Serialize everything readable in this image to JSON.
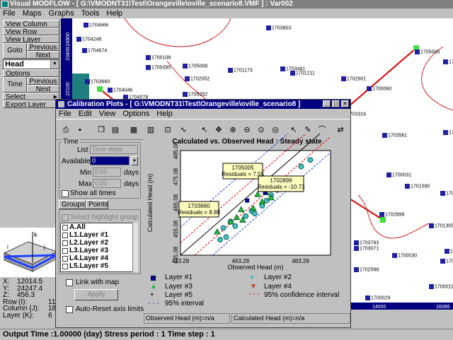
{
  "app": {
    "title": "Visual MODFLOW - [ G:\\VMODNT31\\Test\\Orangeville\\oville_scenario8.VMF ] : Var002"
  },
  "menu": [
    "File",
    "Maps",
    "Graphs",
    "Tools",
    "Help"
  ],
  "sidebar": {
    "view_column": "View Column",
    "view_row": "View Row",
    "view_layer": "View Layer",
    "goto": "Goto",
    "previous": "Previous",
    "next": "Next",
    "head_select": "Head",
    "options": "Options",
    "time": "Time",
    "time_previous": "Previous",
    "time_next": "Next",
    "select": "Select",
    "export_layer": "Export Layer"
  },
  "coords": {
    "x": {
      "label": "X:",
      "value": "12014.5"
    },
    "y": {
      "label": "Y:",
      "value": "24247.4"
    },
    "z": {
      "label": "Z:",
      "value": "456.3"
    },
    "row": {
      "label": "Row",
      "unit": "(I):",
      "value": "11"
    },
    "column": {
      "label": "Column (J):",
      "value": "18"
    },
    "layer": {
      "label": "Layer (K):",
      "value": "6"
    }
  },
  "map": {
    "axis_top": [
      "24800",
      "23400",
      "22100"
    ],
    "axis_bottom": [
      "14000",
      "16086"
    ],
    "wells": [
      {
        "label": "1704666"
      },
      {
        "label": "1703803"
      },
      {
        "label": "1704248"
      },
      {
        "label": "1704674"
      },
      {
        "label": "1700108"
      },
      {
        "label": "1705095"
      },
      {
        "label": "1705008"
      },
      {
        "label": "1703660"
      },
      {
        "label": "1704046"
      },
      {
        "label": "1704078"
      },
      {
        "label": "1702052"
      },
      {
        "label": "1705252"
      },
      {
        "label": "1701173"
      },
      {
        "label": "1703491"
      },
      {
        "label": "1701211"
      },
      {
        "label": "1702601"
      },
      {
        "label": "1700060"
      },
      {
        "label": "1705005"
      },
      {
        "label": "1701767"
      },
      {
        "label": "1703316"
      },
      {
        "label": "1703561"
      },
      {
        "label": "1702889"
      },
      {
        "label": "1702899"
      },
      {
        "label": "1700031"
      },
      {
        "label": "1701595"
      },
      {
        "label": "1701057"
      },
      {
        "label": "1701305"
      },
      {
        "label": "1703783"
      },
      {
        "label": "1703071"
      },
      {
        "label": "1700030"
      },
      {
        "label": "1702598"
      },
      {
        "label": "1700011"
      },
      {
        "label": "1700029"
      },
      {
        "label": "1700317"
      },
      {
        "label": "1704155"
      }
    ]
  },
  "dialog": {
    "title": "Calibration Plots - [ G:\\VMODNT31\\Test\\Orangeville\\oville_scenario8 ]",
    "menu": [
      "File",
      "Edit",
      "View",
      "Options",
      "Help"
    ],
    "time_group": "Time",
    "list_label": "List",
    "list_value": "Time steps",
    "available_label": "Available:",
    "available_value": "0",
    "min_label": "Min",
    "min_value": "0.00",
    "min_unit": "days",
    "max_label": "Max",
    "max_value": "0.00",
    "max_unit": "days",
    "show_all_times": "Show all times",
    "tab_groups": "Groups",
    "tab_points": "Points",
    "highlight": "Select highlight group",
    "groups": [
      "A.All",
      "L1.Layer #1",
      "L2.Layer #2",
      "L3.Layer #3",
      "L4.Layer #4",
      "L5.Layer #5"
    ],
    "link_with_map": "Link with map",
    "apply": "Apply",
    "auto_reset": "Auto-Reset axis limits",
    "status_observed": "Observed Head (m)=n/a",
    "status_calculated": "Calculated Head (m)=n/a",
    "legend": {
      "layer1": "Layer #1",
      "layer2": "Layer #2",
      "layer3": "Layer #3",
      "layer4": "Layer #4",
      "layer5": "Layer #5",
      "conf95": "95% confidence interval",
      "int95": "95% interval"
    },
    "callouts": {
      "a": {
        "well": "1705005",
        "residual": "Residuals = 7.55"
      },
      "b": {
        "well": "1702899",
        "residual": "Residuals = -10.73"
      },
      "c": {
        "well": "1703660",
        "residual": "Residuals = 8.88"
      }
    }
  },
  "chart_data": {
    "type": "scatter",
    "title": "Calculated vs. Observed Head : Steady state",
    "xlabel": "Observed Head (m)",
    "ylabel": "Calculated Head (m)",
    "xlim": [
      443.28,
      493.28
    ],
    "ylim": [
      445.08,
      485.08
    ],
    "x_ticks": [
      "443.28",
      "463.28",
      "483.28"
    ],
    "y_ticks": [
      "445.08",
      "455.08",
      "465.08",
      "475.08",
      "485.08"
    ],
    "series": [
      {
        "name": "Layer #2",
        "marker": "circle",
        "color": "#40c0c0",
        "x": [
          456.5,
          457.6,
          458.5,
          460,
          461.5,
          465,
          467,
          468,
          470.5,
          472,
          473.5,
          475.5,
          477.5,
          479.5,
          483.5,
          486.5
        ],
        "y": [
          451,
          455.5,
          452,
          458,
          456.2,
          460,
          462,
          461,
          464,
          466,
          468,
          470,
          472,
          474,
          479,
          481.5
        ]
      },
      {
        "name": "Layer #3",
        "marker": "triangle",
        "color": "#20c040",
        "x": [
          455.5,
          460,
          462,
          463.5,
          464,
          467.5,
          469,
          470.5,
          471.8,
          473.5,
          476.5
        ],
        "y": [
          454,
          457.8,
          459.5,
          462.5,
          458.5,
          463,
          468.3,
          465.5,
          469,
          467,
          470.5
        ]
      },
      {
        "name": "Layer #1",
        "marker": "square",
        "color": "#000080",
        "x": [
          465.5,
          471.5
        ],
        "y": [
          466,
          469
        ]
      }
    ]
  }
}
